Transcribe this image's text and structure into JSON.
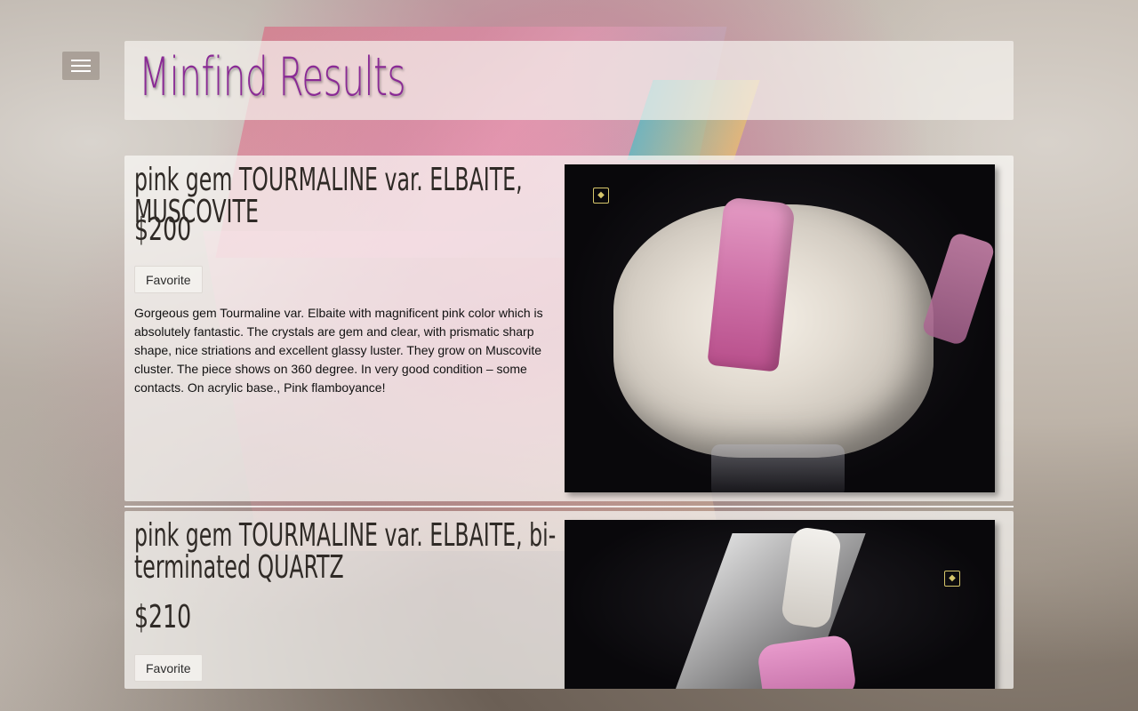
{
  "page": {
    "title": "Minfind Results"
  },
  "nav": {
    "menu_icon": "hamburger-menu-icon"
  },
  "results": [
    {
      "title": "pink gem TOURMALINE var. ELBAITE, MUSCOVITE",
      "price": "$200",
      "favorite_label": "Favorite",
      "description": "Gorgeous gem Tourmaline var. Elbaite with magnificent pink color which is absolutely fantastic. The crystals are gem and clear, with prismatic sharp shape, nice striations and excellent glassy luster. They grow on Muscovite cluster. The piece shows on 360 degree. In very good condition – some contacts. On acrylic base., Pink flamboyance!"
    },
    {
      "title": "pink gem TOURMALINE var. ELBAITE, bi-terminated QUARTZ",
      "price": "$210",
      "favorite_label": "Favorite"
    }
  ],
  "colors": {
    "title": "#8a2a95",
    "text": "#2f2a26",
    "panel": "#f5f2ee"
  }
}
